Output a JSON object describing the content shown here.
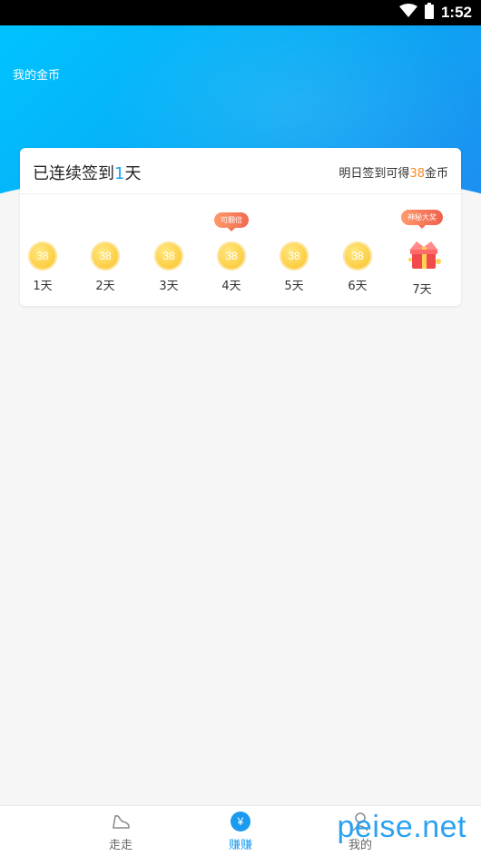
{
  "status_bar": {
    "time": "1:52"
  },
  "hero": {
    "title": "我的金币"
  },
  "checkin": {
    "streak_prefix": "已连续签到",
    "streak_days": "1",
    "streak_suffix": "天",
    "tomorrow_prefix": "明日签到可得",
    "tomorrow_coins": "38",
    "tomorrow_suffix": "金币",
    "days": [
      {
        "label": "1天",
        "coins": "38"
      },
      {
        "label": "2天",
        "coins": "38"
      },
      {
        "label": "3天",
        "coins": "38"
      },
      {
        "label": "4天",
        "coins": "38",
        "badge": "可翻倍"
      },
      {
        "label": "5天",
        "coins": "38"
      },
      {
        "label": "6天",
        "coins": "38"
      },
      {
        "label": "7天",
        "badge": "神秘大奖",
        "icon": "gift-box-icon"
      }
    ]
  },
  "bottom_nav": [
    {
      "label": "走走",
      "icon": "shoe-icon",
      "active": false
    },
    {
      "label": "赚赚",
      "icon": "yen-coin-icon",
      "active": true
    },
    {
      "label": "我的",
      "icon": "person-icon",
      "active": false
    }
  ],
  "watermark": {
    "text": "peise.net"
  },
  "colors": {
    "accent": "#1a9bf0",
    "coin_orange": "#f58b22"
  }
}
